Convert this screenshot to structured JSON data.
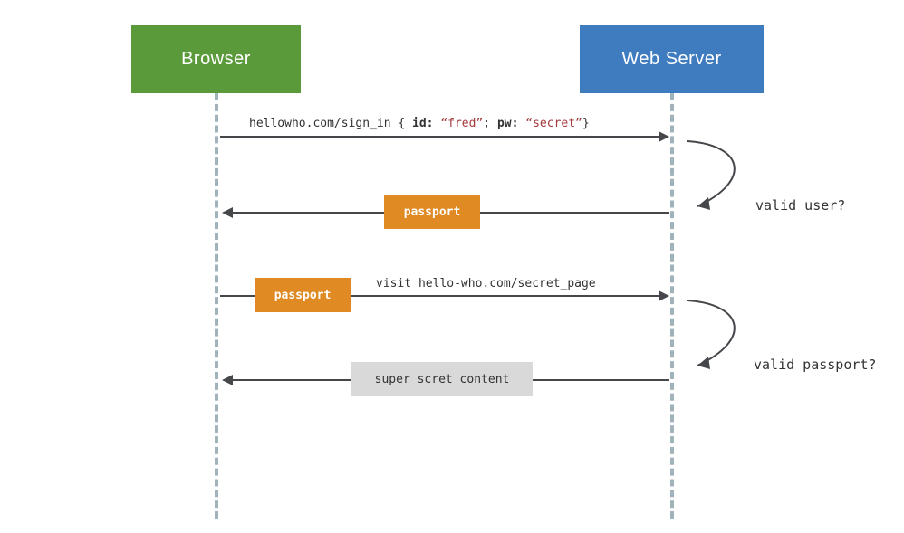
{
  "participants": {
    "browser": "Browser",
    "server": "Web Server"
  },
  "messages": {
    "signin_prefix": "hellowho.com/sign_in { ",
    "signin_id_key": "id:",
    "signin_id_val": " “fred”",
    "signin_sep": "; ",
    "signin_pw_key": "pw:",
    "signin_pw_val": " “secret”",
    "signin_suffix": "}",
    "passport": "passport",
    "visit_prefix": "visit ",
    "visit_url": "hello-who.com/secret_page",
    "secret_content": "super scret content"
  },
  "checks": {
    "valid_user": "valid user?",
    "valid_passport": "valid passport?"
  },
  "colors": {
    "browser_box": "#5a9a3b",
    "server_box": "#3e7bbf",
    "lifeline": "#a0b3bb",
    "line": "#45474b",
    "token_passport": "#e08a24",
    "token_secret": "#d9d9d9"
  }
}
